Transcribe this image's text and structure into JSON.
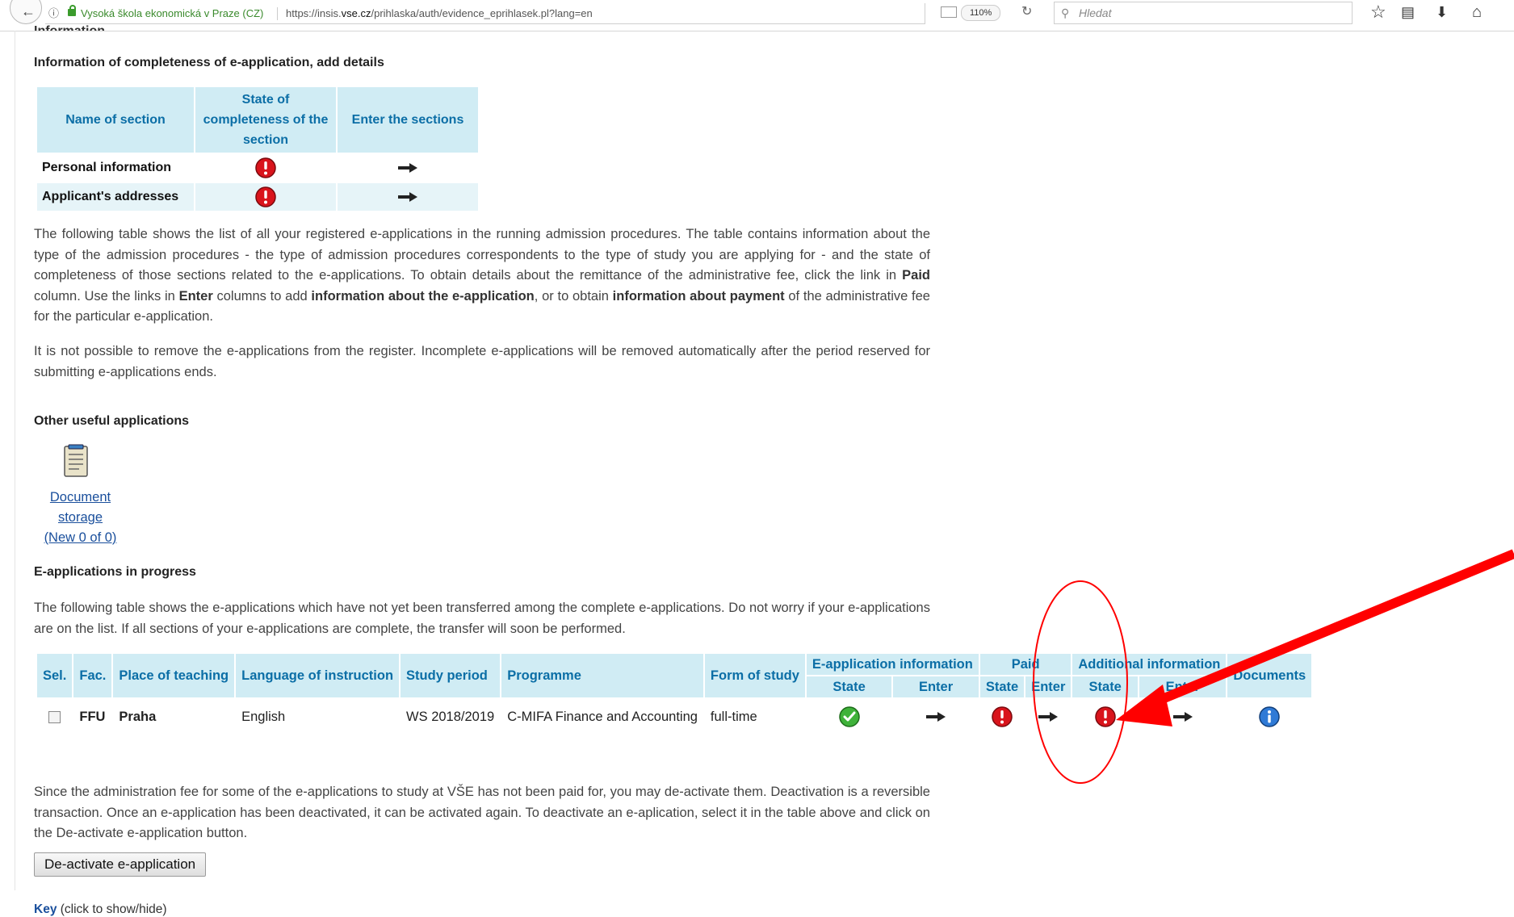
{
  "browser": {
    "site_identity": "Vysoká škola ekonomická v Praze (CZ)",
    "url_prefix": "https://insis.",
    "url_domain": "vse.cz",
    "url_path": "/prihlaska/auth/evidence_eprihlasek.pl?lang=en",
    "zoom": "110%",
    "search_placeholder": "Hledat"
  },
  "completeness": {
    "title": "Information of completeness of e-application, add details",
    "headers": [
      "Name of section",
      "State of completeness of the section",
      "Enter the sections"
    ],
    "rows": [
      {
        "name": "Personal information",
        "state_icon": "error-icon",
        "enter_icon": "arrow-right-icon"
      },
      {
        "name": "Applicant's addresses",
        "state_icon": "error-icon",
        "enter_icon": "arrow-right-icon"
      }
    ]
  },
  "intro": {
    "p1_a": "The following table shows the list of all your registered e-applications in the running admission procedures. The table contains information about the type of the admission procedures - the type of admission procedures correspondents to the type of study you are applying for - and the state of completeness of those sections related to the e-applications. To obtain details about the remittance of the administrative fee, click the link in ",
    "p1_paid": "Paid",
    "p1_b": " column. Use the links in ",
    "p1_enter": "Enter",
    "p1_c": " columns to add ",
    "p1_info_app": "information about the e-application",
    "p1_d": ", or to obtain ",
    "p1_info_pay": "information about payment",
    "p1_e": " of the administrative fee for the particular e-application.",
    "p2": "It is not possible to remove the e-applications from the register. Incomplete e-applications will be removed automatically after the period reserved for submitting e-applications ends."
  },
  "useful": {
    "title": "Other useful applications",
    "doc_link_1": "Document",
    "doc_link_2": "storage",
    "doc_link_3": "(New 0 of 0)"
  },
  "progress": {
    "title": "E-applications in progress",
    "text": "The following table shows the e-applications which have not yet been transferred among the complete e-applications. Do not worry if your e-applications are on the list. If all sections of your e-applications are complete, the transfer will soon be performed.",
    "headers": {
      "sel": "Sel.",
      "fac": "Fac.",
      "place": "Place of teaching",
      "lang": "Language of instruction",
      "period": "Study period",
      "programme": "Programme",
      "form": "Form of study",
      "einfo": "E-application information",
      "paid": "Paid",
      "addinfo": "Additional information",
      "documents": "Documents",
      "state": "State",
      "enter": "Enter"
    },
    "row": {
      "fac": "FFU",
      "place": "Praha",
      "lang": "English",
      "period": "WS 2018/2019",
      "programme": "C-MIFA Finance and Accounting",
      "form": "full-time"
    },
    "deactivate_text": "Since the administration fee for some of the e-applications to study at VŠE has not been paid for, you may de-activate them. Deactivation is a reversible transaction. Once an e-application has been deactivated, it can be activated again. To deactivate an e-aplication, select it in the table above and click on the De-activate e-application button.",
    "deactivate_button": "De-activate e-application",
    "key_link": "Key",
    "key_hint": " (click to show/hide)"
  },
  "colors": {
    "header_bg": "#d0ecf4",
    "header_text": "#0b6ea6",
    "link": "#1a4f9c",
    "annotation": "#ff0000"
  }
}
